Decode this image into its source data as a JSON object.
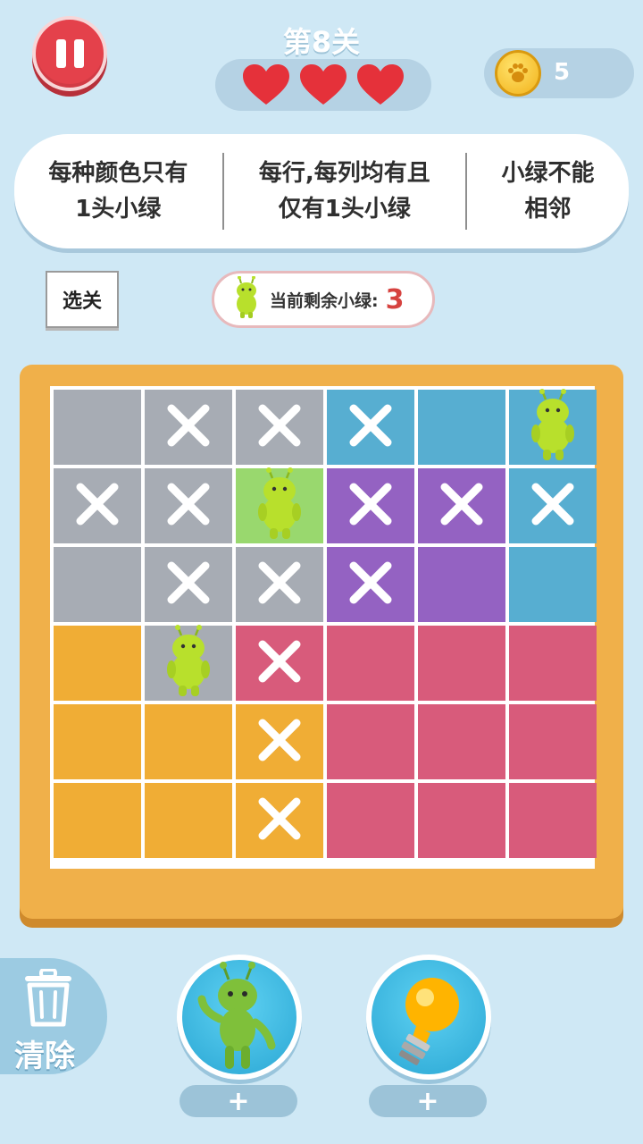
{
  "header": {
    "level_title": "第8关",
    "lives": 3,
    "coins": "5"
  },
  "rules": {
    "rule1": "每种颜色只有\n1头小绿",
    "rule2": "每行,每列均有且\n仅有1头小绿",
    "rule3": "小绿不能\n相邻"
  },
  "controls": {
    "select_level_label": "选关",
    "remaining_label": "当前剩余小绿:",
    "remaining_value": "3",
    "clear_label": "清除",
    "plus_label_1": "+",
    "plus_label_2": "+"
  },
  "colors": {
    "gray": "#a7acb4",
    "blue": "#57aed1",
    "purple": "#9462c2",
    "pink": "#d85b7b",
    "orange": "#f0ad35",
    "green": "#99d86e",
    "alien": "#b8e02c",
    "board_frame": "#f0b04a",
    "heart": "#e5313a"
  },
  "board": {
    "rows": 6,
    "cols": 6,
    "cells": [
      [
        "gray",
        "gray",
        "gray",
        "blue",
        "blue",
        "blue"
      ],
      [
        "gray",
        "gray",
        "green",
        "purple",
        "purple",
        "blue"
      ],
      [
        "gray",
        "gray",
        "gray",
        "purple",
        "purple",
        "blue"
      ],
      [
        "orange",
        "gray",
        "pink",
        "pink",
        "pink",
        "pink"
      ],
      [
        "orange",
        "orange",
        "orange",
        "pink",
        "pink",
        "pink"
      ],
      [
        "orange",
        "orange",
        "orange",
        "pink",
        "pink",
        "pink"
      ]
    ],
    "marks": [
      [
        "",
        "x",
        "x",
        "x",
        "",
        "alien"
      ],
      [
        "x",
        "x",
        "alien",
        "x",
        "x",
        "x"
      ],
      [
        "",
        "x",
        "x",
        "x",
        "",
        ""
      ],
      [
        "",
        "alien",
        "x",
        "",
        "",
        ""
      ],
      [
        "",
        "",
        "x",
        "",
        "",
        ""
      ],
      [
        "",
        "",
        "x",
        "",
        "",
        ""
      ]
    ]
  },
  "icons": {
    "pause": "pause-icon",
    "heart": "heart-icon",
    "coin": "paw-coin-icon",
    "trash": "trash-icon",
    "alien": "alien-icon",
    "hint": "lightbulb-icon",
    "x": "x-mark-icon"
  }
}
